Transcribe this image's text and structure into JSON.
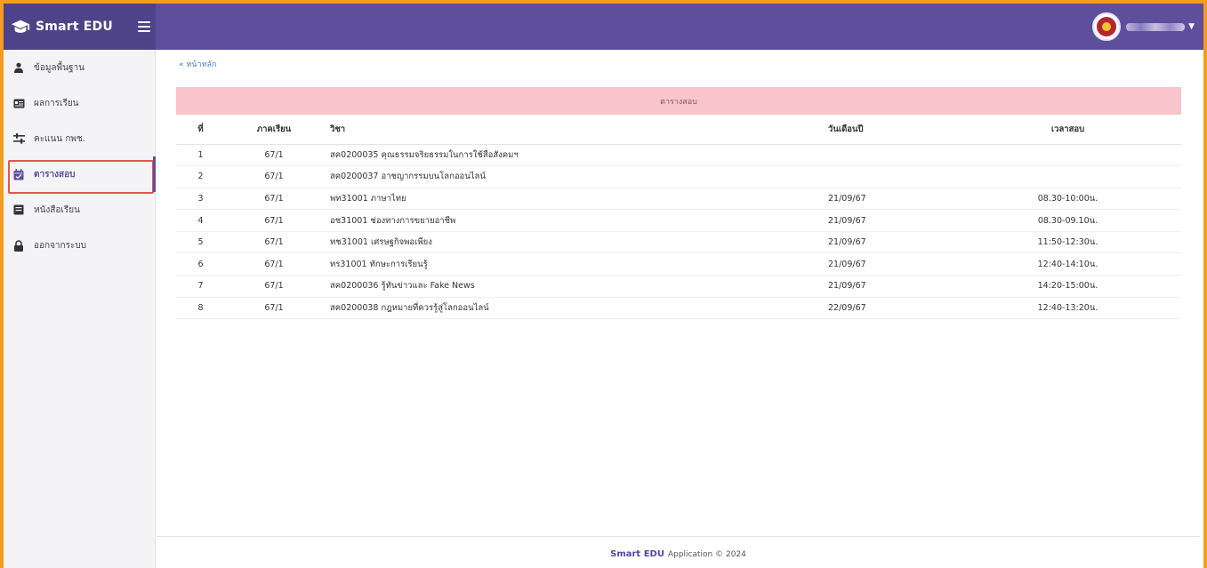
{
  "app": {
    "brand": "Smart EDU"
  },
  "user": {
    "avatar_icon": "school-seal-icon"
  },
  "sidebar": {
    "items": [
      {
        "label": "ข้อมูลพื้นฐาน",
        "icon": "user-icon"
      },
      {
        "label": "ผลการเรียน",
        "icon": "id-card-icon"
      },
      {
        "label": "คะแนน กพช.",
        "icon": "sliders-icon"
      },
      {
        "label": "ตารางสอบ",
        "icon": "calendar-check-icon",
        "active": true
      },
      {
        "label": "หนังสือเรียน",
        "icon": "book-icon"
      },
      {
        "label": "ออกจากระบบ",
        "icon": "lock-icon"
      }
    ]
  },
  "breadcrumb": {
    "home": "« หน้าหลัก"
  },
  "card": {
    "title": "ตารางสอบ"
  },
  "table": {
    "headers": {
      "no": "ที่",
      "term": "ภาคเรียน",
      "subject": "วิชา",
      "date": "วันเดือนปี",
      "time": "เวลาสอบ"
    },
    "rows": [
      {
        "no": "1",
        "term": "67/1",
        "subject": "สค0200035 คุณธรรมจริยธรรมในการใช้สื่อสังคมฯ",
        "date": "",
        "time": ""
      },
      {
        "no": "2",
        "term": "67/1",
        "subject": "สค0200037 อาชญากรรมบนโลกออนไลน์",
        "date": "",
        "time": ""
      },
      {
        "no": "3",
        "term": "67/1",
        "subject": "พท31001 ภาษาไทย",
        "date": "21/09/67",
        "time": "08.30-10:00น."
      },
      {
        "no": "4",
        "term": "67/1",
        "subject": "อช31001 ช่องทางการขยายอาชีพ",
        "date": "21/09/67",
        "time": "08.30-09.10น."
      },
      {
        "no": "5",
        "term": "67/1",
        "subject": "ทช31001 เศรษฐกิจพอเพียง",
        "date": "21/09/67",
        "time": "11:50-12:30น."
      },
      {
        "no": "6",
        "term": "67/1",
        "subject": "ทร31001 ทักษะการเรียนรู้",
        "date": "21/09/67",
        "time": "12:40-14:10น."
      },
      {
        "no": "7",
        "term": "67/1",
        "subject": "สค0200036 รู้ทันข่าวและ Fake News",
        "date": "21/09/67",
        "time": "14:20-15:00น."
      },
      {
        "no": "8",
        "term": "67/1",
        "subject": "สค0200038 กฎหมายที่ควรรู้สู่โลกออนไลน์",
        "date": "22/09/67",
        "time": "12:40-13:20น."
      }
    ]
  },
  "footer": {
    "brand": "Smart EDU",
    "text": "Application © 2024"
  },
  "colors": {
    "topbar": "#5d4f9c",
    "frame": "#f39c1f",
    "card_header": "#f9c4cb",
    "active_outline": "#e2574c"
  }
}
